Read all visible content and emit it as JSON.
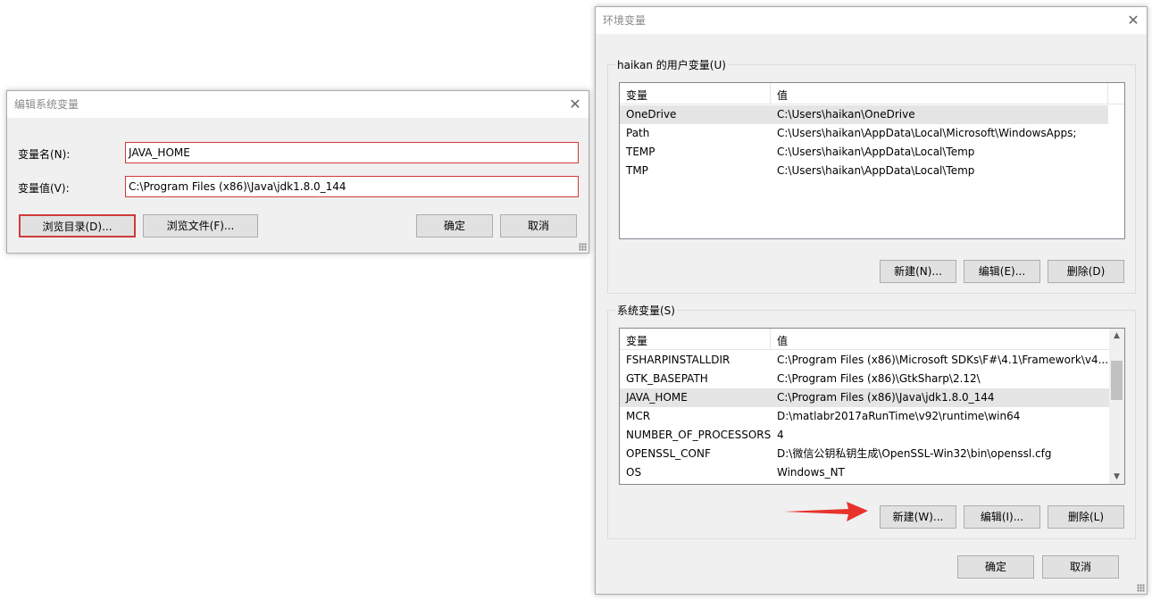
{
  "edit_dialog": {
    "title": "编辑系统变量",
    "close_icon": "close-icon",
    "name_label": "变量名(N):",
    "name_value": "JAVA_HOME",
    "value_label": "变量值(V):",
    "value_value": "C:\\Program Files (x86)\\Java\\jdk1.8.0_144",
    "browse_dir": "浏览目录(D)...",
    "browse_file": "浏览文件(F)...",
    "ok": "确定",
    "cancel": "取消"
  },
  "env_dialog": {
    "title": "环境变量",
    "close_icon": "close-icon",
    "user_group_title": "haikan 的用户变量(U)",
    "user_columns": [
      "变量",
      "值"
    ],
    "user_rows": [
      {
        "name": "OneDrive",
        "value": "C:\\Users\\haikan\\OneDrive"
      },
      {
        "name": "Path",
        "value": "C:\\Users\\haikan\\AppData\\Local\\Microsoft\\WindowsApps;"
      },
      {
        "name": "TEMP",
        "value": "C:\\Users\\haikan\\AppData\\Local\\Temp"
      },
      {
        "name": "TMP",
        "value": "C:\\Users\\haikan\\AppData\\Local\\Temp"
      }
    ],
    "user_new": "新建(N)...",
    "user_edit": "编辑(E)...",
    "user_delete": "删除(D)",
    "sys_group_title": "系统变量(S)",
    "sys_columns": [
      "变量",
      "值"
    ],
    "sys_rows": [
      {
        "name": "FSHARPINSTALLDIR",
        "value": "C:\\Program Files (x86)\\Microsoft SDKs\\F#\\4.1\\Framework\\v4...."
      },
      {
        "name": "GTK_BASEPATH",
        "value": "C:\\Program Files (x86)\\GtkSharp\\2.12\\"
      },
      {
        "name": "JAVA_HOME",
        "value": "C:\\Program Files (x86)\\Java\\jdk1.8.0_144"
      },
      {
        "name": "MCR",
        "value": "D:\\matlabr2017aRunTime\\v92\\runtime\\win64"
      },
      {
        "name": "NUMBER_OF_PROCESSORS",
        "value": "4"
      },
      {
        "name": "OPENSSL_CONF",
        "value": "D:\\微信公钥私钥生成\\OpenSSL-Win32\\bin\\openssl.cfg"
      },
      {
        "name": "OS",
        "value": "Windows_NT"
      }
    ],
    "sys_new": "新建(W)...",
    "sys_edit": "编辑(I)...",
    "sys_delete": "删除(L)",
    "ok": "确定",
    "cancel": "取消",
    "annotation_color": "#e8322d"
  }
}
